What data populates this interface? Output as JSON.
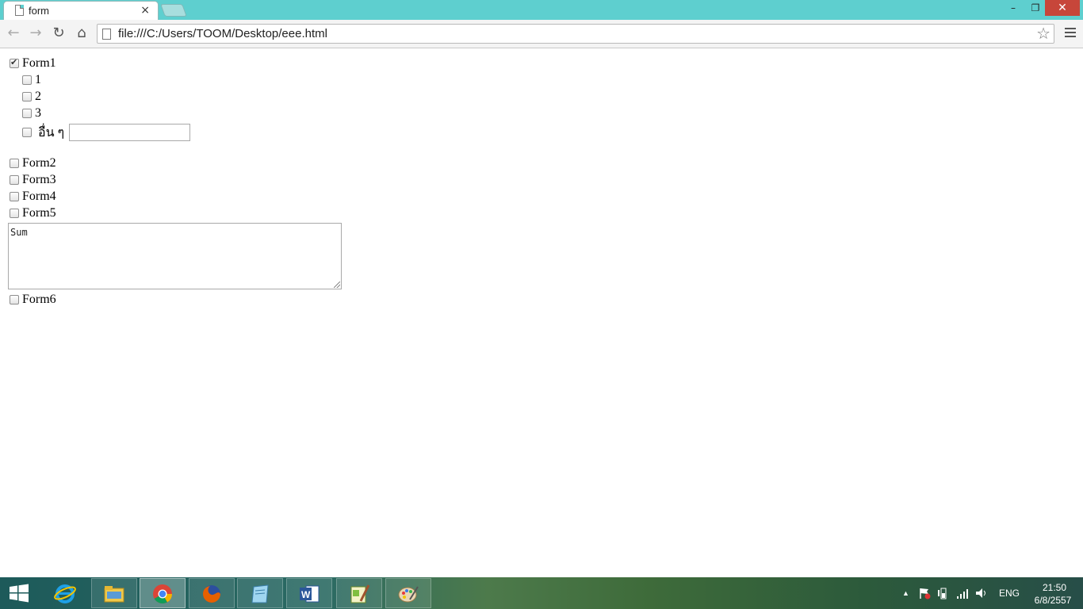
{
  "browser": {
    "tab_title": "form",
    "tab_close": "×",
    "url": "file:///C:/Users/TOOM/Desktop/eee.html",
    "window_buttons": {
      "minimize": "–",
      "restore": "❐",
      "close": "✕"
    },
    "icons": {
      "back": "←",
      "forward": "→",
      "reload": "↻",
      "home": "⌂",
      "star": "☆"
    }
  },
  "form": {
    "form1": {
      "label": "Form1",
      "checked": true
    },
    "form1_options": [
      {
        "label": "1",
        "checked": false
      },
      {
        "label": "2",
        "checked": false
      },
      {
        "label": "3",
        "checked": false
      }
    ],
    "other": {
      "label": "อื่น ๆ",
      "value": ""
    },
    "form2": {
      "label": "Form2",
      "checked": false
    },
    "form3": {
      "label": "Form3",
      "checked": false
    },
    "form4": {
      "label": "Form4",
      "checked": false
    },
    "form5": {
      "label": "Form5",
      "checked": false
    },
    "sum_text": "Sum",
    "form6": {
      "label": "Form6",
      "checked": false
    }
  },
  "taskbar": {
    "apps": [
      "start-menu",
      "internet-explorer",
      "file-explorer",
      "chrome",
      "firefox",
      "notepad",
      "word",
      "notepad-plus",
      "paint"
    ],
    "active_app": "chrome",
    "tray": {
      "up_arrow": "▲",
      "language": "ENG",
      "time": "21:50",
      "date": "6/8/2557"
    }
  },
  "colors": {
    "titlebar": "#5ecfcf",
    "close_button": "#c7463a"
  }
}
